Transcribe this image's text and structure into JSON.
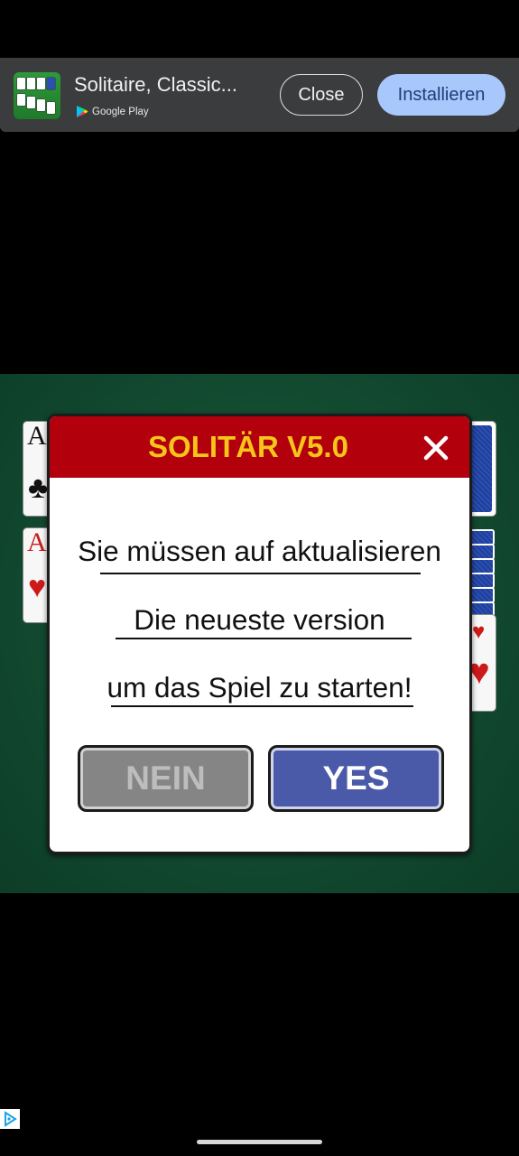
{
  "banner": {
    "app_title": "Solitaire, Classic...",
    "store_label": "Google Play",
    "close_label": "Close",
    "install_label": "Installieren"
  },
  "game": {
    "cards": [
      {
        "rank": "A",
        "suit": "♣",
        "color": "#111111"
      },
      {
        "rank": "A",
        "suit": "♥",
        "color": "#cc1a1a"
      }
    ]
  },
  "dialog": {
    "title": "SOLITÄR V5.0",
    "lines": [
      "Sie müssen auf aktualisieren",
      "Die neueste version",
      "um das Spiel zu starten!"
    ],
    "no_label": "NEIN",
    "yes_label": "YES"
  },
  "colors": {
    "header_red": "#b3000d",
    "title_yellow": "#f6c51a",
    "yes_blue": "#4a5aa8",
    "no_gray": "#858585",
    "table_green": "#124a30",
    "install_button": "#a8c7fa"
  },
  "icons": {
    "close_dialog": "close-x-icon",
    "ad_choices": "ad-choices-icon",
    "play_store": "google-play-icon"
  }
}
